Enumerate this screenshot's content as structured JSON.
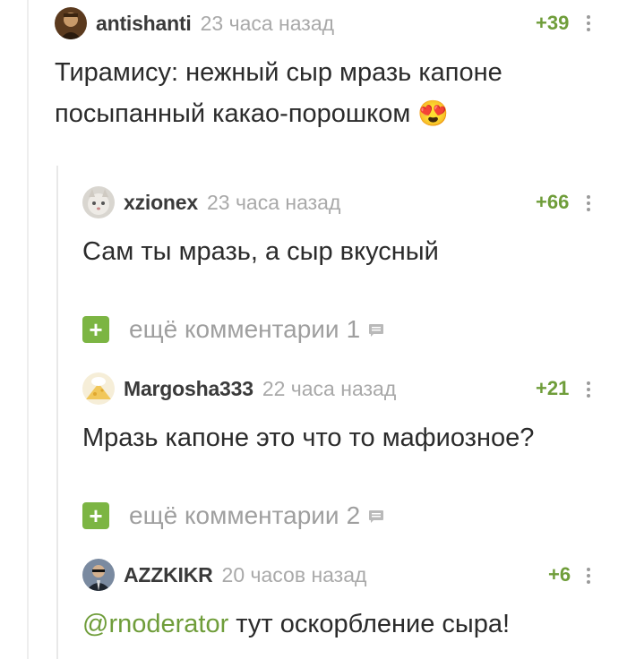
{
  "comments": [
    {
      "username": "antishanti",
      "time": "23 часа назад",
      "rating": "+39",
      "text": "Тирамису: нежный сыр мразь капоне посыпанный какао-порошком",
      "emoji": "😍"
    },
    {
      "username": "xzionex",
      "time": "23 часа назад",
      "rating": "+66",
      "text": "Сам ты мразь, а сыр вкусный"
    },
    {
      "username": "Margosha333",
      "time": "22 часа назад",
      "rating": "+21",
      "text": "Мразь капоне это что то мафиозное?"
    },
    {
      "username": "AZZKIKR",
      "time": "20 часов назад",
      "rating": "+6",
      "mention": "@rnoderator",
      "text": " тут оскорбление сыра!"
    }
  ],
  "more_comments": [
    {
      "plus": "+",
      "label": "ещё комментарии",
      "count": "1"
    },
    {
      "plus": "+",
      "label": "ещё комментарии",
      "count": "2"
    }
  ],
  "colors": {
    "accent": "#7cb543",
    "rating": "#6f9d3a",
    "meta": "#a9a9a9"
  }
}
